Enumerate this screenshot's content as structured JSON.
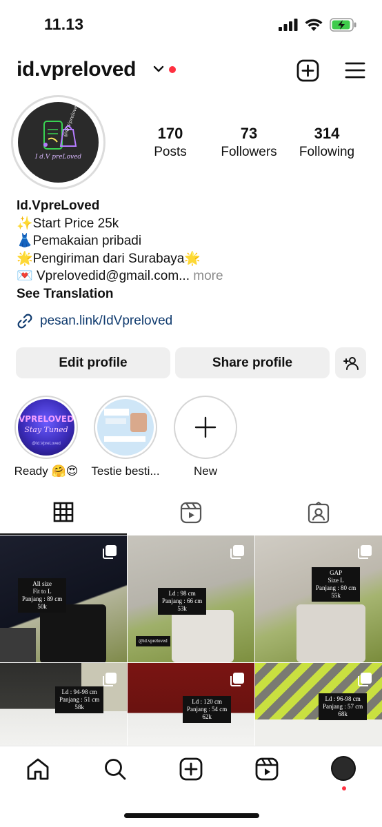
{
  "status_bar": {
    "time": "11.13",
    "battery_color": "#3ecb4b"
  },
  "header": {
    "username": "id.vpreloved",
    "notification_dot_color": "#ff3040"
  },
  "profile": {
    "avatar_caption": "I d.V preLoved",
    "avatar_handle": "@id.Vpreloved",
    "stats": [
      {
        "value": "170",
        "label": "Posts"
      },
      {
        "value": "73",
        "label": "Followers"
      },
      {
        "value": "314",
        "label": "Following"
      }
    ]
  },
  "bio": {
    "name": "Id.VpreLoved",
    "lines": [
      {
        "emoji": "✨",
        "text": "Start Price 25k"
      },
      {
        "emoji": "👗",
        "text": "Pemakaian pribadi"
      },
      {
        "emoji": "🌟",
        "text": "Pengiriman dari Surabaya🌟"
      },
      {
        "emoji": "💌",
        "text": " Vprelovedid@gmail.com..."
      }
    ],
    "more": "more",
    "see_translation": "See Translation",
    "link": "pesan.link/IdVpreloved"
  },
  "buttons": {
    "edit": "Edit profile",
    "share": "Share profile"
  },
  "highlights": [
    {
      "label": "Ready 🤗😍",
      "cover_text": "VPRELOVED",
      "cover_sub": "Stay Tuned",
      "cover_handle": "@Id.VpreLoved"
    },
    {
      "label": "Testie besti..."
    },
    {
      "label": "New"
    }
  ],
  "tabs": [
    "grid",
    "reels",
    "tagged"
  ],
  "posts": [
    {
      "tag": [
        "All size",
        "Fit to L",
        "Panjang : 89 cm",
        "50k"
      ]
    },
    {
      "tag": [
        "Ld : 98 cm",
        "Panjang : 66 cm",
        "53k"
      ],
      "watermark": "@id.vpreloved"
    },
    {
      "tag": [
        "GAP",
        "Size L",
        "Panjang : 80 cm",
        "55k"
      ]
    },
    {
      "tag": [
        "Ld : 94-98 cm",
        "Panjang : 51 cm",
        "58k"
      ]
    },
    {
      "tag": [
        "Ld : 120 cm",
        "Panjang : 54 cm",
        "62k"
      ]
    },
    {
      "tag": [
        "Ld : 96-98 cm",
        "Panjang : 57 cm",
        "68k"
      ]
    }
  ],
  "bottom_nav": [
    "home",
    "search",
    "create",
    "reels",
    "profile"
  ]
}
